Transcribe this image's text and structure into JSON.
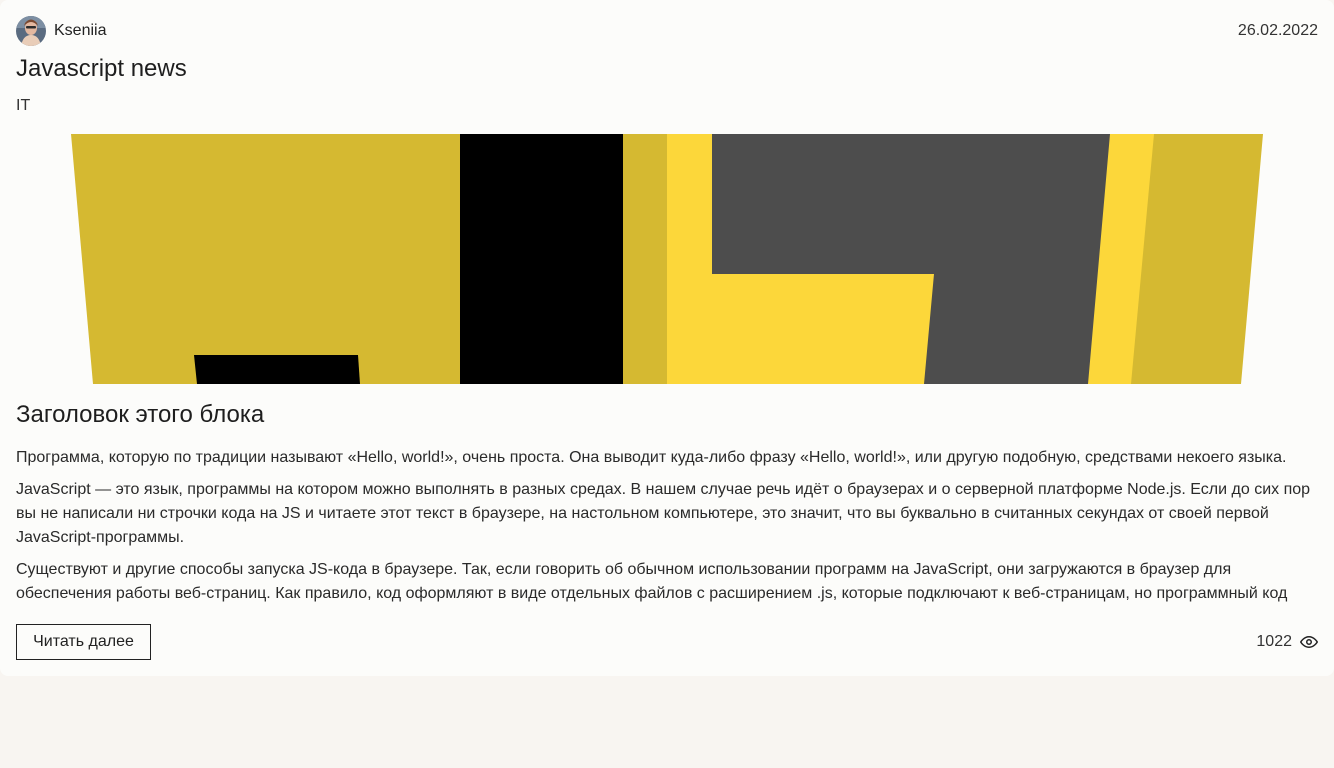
{
  "post": {
    "author": {
      "name": "Kseniia",
      "avatar_icon": "avatar-photo"
    },
    "date": "26.02.2022",
    "title": "Javascript news",
    "category": "IT",
    "banner_colors": {
      "dark_yellow": "#d5b931",
      "yellow": "#fcd73a",
      "gray": "#4d4d4d",
      "black": "#000000"
    },
    "block_title": "Заголовок этого блока",
    "paragraphs": [
      "Программа, которую по традиции называют «Hello, world!», очень проста. Она выводит куда-либо фразу «Hello, world!», или другую подобную, средствами некоего языка.",
      "JavaScript — это язык, программы на котором можно выполнять в разных средах. В нашем случае речь идёт о браузерах и о серверной платформе Node.js. Если до сих пор вы не написали ни строчки кода на JS и читаете этот текст в браузере, на настольном компьютере, это значит, что вы буквально в считанных секундах от своей первой JavaScript-программы.",
      "Существуют и другие способы запуска JS-кода в браузере. Так, если говорить об обычном использовании программ на JavaScript, они загружаются в браузер для обеспечения работы веб-страниц. Как правило, код оформляют в виде отдельных файлов с расширением .js, которые подключают к веб-страницам, но программный код"
    ],
    "read_more_label": "Читать далее",
    "views": "1022",
    "views_icon": "eye-icon"
  }
}
